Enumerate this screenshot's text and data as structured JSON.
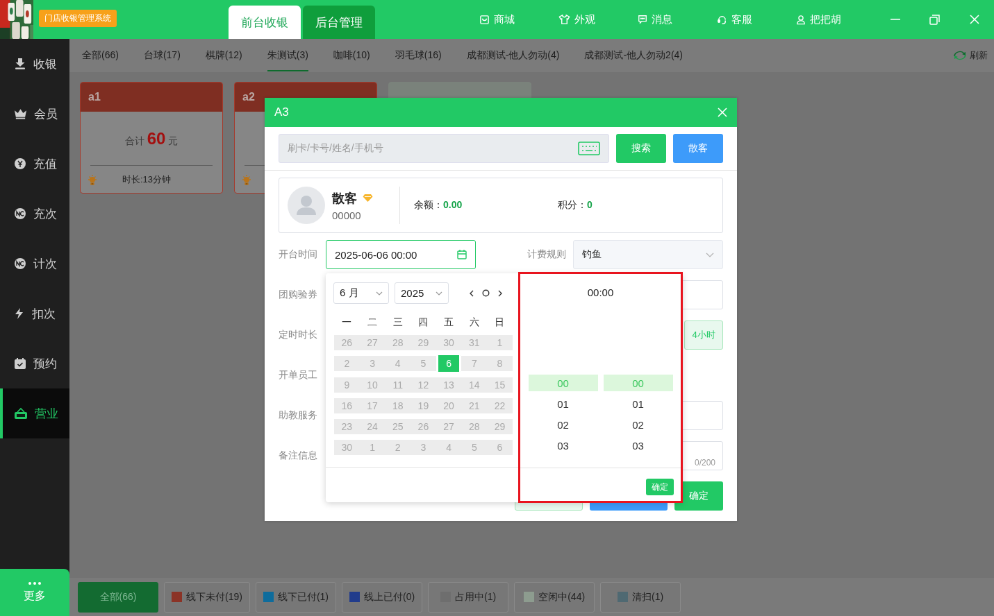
{
  "header": {
    "brand": "门店收银管理系统",
    "tabs": [
      {
        "label": "前台收银",
        "selected": true
      },
      {
        "label": "后台管理",
        "selected": false
      }
    ],
    "menu": [
      {
        "label": "商城"
      },
      {
        "label": "外观"
      },
      {
        "label": "消息"
      },
      {
        "label": "客服"
      },
      {
        "label": "把把胡"
      }
    ]
  },
  "sidebar": {
    "items": [
      {
        "label": "收银",
        "selected": false
      },
      {
        "label": "会员",
        "selected": false
      },
      {
        "label": "充值",
        "selected": false
      },
      {
        "label": "充次",
        "selected": false
      },
      {
        "label": "计次",
        "selected": false
      },
      {
        "label": "扣次",
        "selected": false
      },
      {
        "label": "预约",
        "selected": false
      },
      {
        "label": "营业",
        "selected": true
      }
    ],
    "more": "更多"
  },
  "category_tabs": {
    "items": [
      {
        "label": "全部(66)",
        "selected": false
      },
      {
        "label": "台球(17)",
        "selected": false
      },
      {
        "label": "棋牌(12)",
        "selected": false
      },
      {
        "label": "朱测试(3)",
        "selected": true
      },
      {
        "label": "咖啡(10)",
        "selected": false
      },
      {
        "label": "羽毛球(16)",
        "selected": false
      },
      {
        "label": "成都测试-他人勿动(4)",
        "selected": false
      },
      {
        "label": "成都测试-他人勿动2(4)",
        "selected": false
      }
    ],
    "refresh": "刷新"
  },
  "cards": [
    {
      "title": "a1",
      "color": "#7f2e22",
      "total_label": "合计",
      "amount": "60",
      "unit": "元",
      "duration": "时长:13分钟"
    },
    {
      "title": "a2",
      "color": "#7f2e22"
    },
    {
      "color": "#7a827b"
    }
  ],
  "dialog": {
    "title": "A3",
    "search": {
      "placeholder": "刷卡/卡号/姓名/手机号",
      "search_button": "搜索",
      "guest_button": "散客"
    },
    "member": {
      "name": "散客",
      "code": "00000",
      "balance_label": "余额：",
      "balance": "0.00",
      "points_label": "积分：",
      "points": "0"
    },
    "open_time": {
      "label": "开台时间",
      "value": "2025-06-06 00:00"
    },
    "billing_rule": {
      "label": "计费规则",
      "value": "钓鱼"
    },
    "fields": [
      {
        "label": "团购验券",
        "kind": "input"
      },
      {
        "label": "定时时长",
        "kind": "duration",
        "option": "4小时"
      },
      {
        "label": "开单员工",
        "kind": "blank"
      },
      {
        "label": "助教服务",
        "kind": "input"
      },
      {
        "label": "备注信息",
        "kind": "textarea",
        "counter": "0/200"
      }
    ],
    "confirm": "确定"
  },
  "date_picker": {
    "month": "6 月",
    "year": "2025",
    "weekdays": [
      "一",
      "二",
      "三",
      "四",
      "五",
      "六",
      "日"
    ],
    "weeks": [
      [
        {
          "label": "26",
          "disabled": true,
          "selected": false
        },
        {
          "label": "27",
          "disabled": true,
          "selected": false
        },
        {
          "label": "28",
          "disabled": true,
          "selected": false
        },
        {
          "label": "29",
          "disabled": true,
          "selected": false
        },
        {
          "label": "30",
          "disabled": true,
          "selected": false
        },
        {
          "label": "31",
          "disabled": true,
          "selected": false
        },
        {
          "label": "1",
          "disabled": true,
          "selected": false
        }
      ],
      [
        {
          "label": "2",
          "disabled": true,
          "selected": false
        },
        {
          "label": "3",
          "disabled": true,
          "selected": false
        },
        {
          "label": "4",
          "disabled": true,
          "selected": false
        },
        {
          "label": "5",
          "disabled": true,
          "selected": false
        },
        {
          "label": "6",
          "disabled": false,
          "selected": true
        },
        {
          "label": "7",
          "disabled": true,
          "selected": false
        },
        {
          "label": "8",
          "disabled": true,
          "selected": false
        }
      ],
      [
        {
          "label": "9",
          "disabled": true,
          "selected": false
        },
        {
          "label": "10",
          "disabled": true,
          "selected": false
        },
        {
          "label": "11",
          "disabled": true,
          "selected": false
        },
        {
          "label": "12",
          "disabled": true,
          "selected": false
        },
        {
          "label": "13",
          "disabled": true,
          "selected": false
        },
        {
          "label": "14",
          "disabled": true,
          "selected": false
        },
        {
          "label": "15",
          "disabled": true,
          "selected": false
        }
      ],
      [
        {
          "label": "16",
          "disabled": true,
          "selected": false
        },
        {
          "label": "17",
          "disabled": true,
          "selected": false
        },
        {
          "label": "18",
          "disabled": true,
          "selected": false
        },
        {
          "label": "19",
          "disabled": true,
          "selected": false
        },
        {
          "label": "20",
          "disabled": true,
          "selected": false
        },
        {
          "label": "21",
          "disabled": true,
          "selected": false
        },
        {
          "label": "22",
          "disabled": true,
          "selected": false
        }
      ],
      [
        {
          "label": "23",
          "disabled": true,
          "selected": false
        },
        {
          "label": "24",
          "disabled": true,
          "selected": false
        },
        {
          "label": "25",
          "disabled": true,
          "selected": false
        },
        {
          "label": "26",
          "disabled": true,
          "selected": false
        },
        {
          "label": "27",
          "disabled": true,
          "selected": false
        },
        {
          "label": "28",
          "disabled": true,
          "selected": false
        },
        {
          "label": "29",
          "disabled": true,
          "selected": false
        }
      ],
      [
        {
          "label": "30",
          "disabled": true,
          "selected": false
        },
        {
          "label": "1",
          "disabled": true,
          "selected": false
        },
        {
          "label": "2",
          "disabled": true,
          "selected": false
        },
        {
          "label": "3",
          "disabled": true,
          "selected": false
        },
        {
          "label": "4",
          "disabled": true,
          "selected": false
        },
        {
          "label": "5",
          "disabled": true,
          "selected": false
        },
        {
          "label": "6",
          "disabled": true,
          "selected": false
        }
      ]
    ],
    "time": {
      "value": "00:00",
      "hours": [
        {
          "label": "00",
          "selected": true
        },
        {
          "label": "01",
          "selected": false
        },
        {
          "label": "02",
          "selected": false
        },
        {
          "label": "03",
          "selected": false
        }
      ],
      "minutes": [
        {
          "label": "00",
          "selected": true
        },
        {
          "label": "01",
          "selected": false
        },
        {
          "label": "02",
          "selected": false
        },
        {
          "label": "03",
          "selected": false
        }
      ],
      "confirm": "确定"
    }
  },
  "filters": {
    "items": [
      {
        "label": "全部(66)",
        "selected": true
      },
      {
        "label": "线下未付(19)",
        "color": "#8b3326",
        "selected": false
      },
      {
        "label": "线下已付(1)",
        "color": "#0e6c9c",
        "selected": false
      },
      {
        "label": "线上已付(0)",
        "color": "#213c8c",
        "selected": false
      },
      {
        "label": "占用中(1)",
        "color": "#6e6e6e",
        "selected": false
      },
      {
        "label": "空闲中(44)",
        "color": "#8d9c8f",
        "selected": false
      },
      {
        "label": "清扫(1)",
        "color": "#4f6972",
        "selected": false
      }
    ]
  }
}
